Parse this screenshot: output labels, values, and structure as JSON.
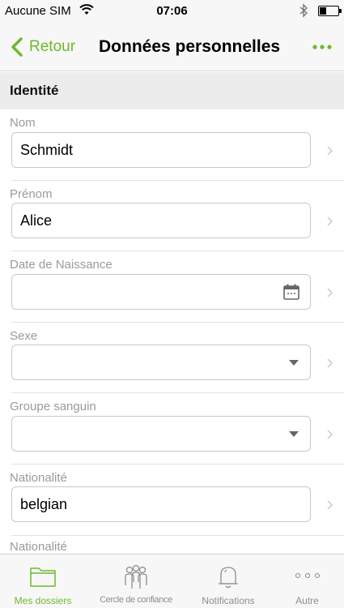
{
  "status_bar": {
    "carrier": "Aucune SIM",
    "time": "07:06"
  },
  "nav": {
    "back_label": "Retour",
    "title": "Données personnelles",
    "more_icon": "ellipsis-icon",
    "accent_color": "#6fb82d"
  },
  "section": {
    "title": "Identité"
  },
  "fields": [
    {
      "label": "Nom",
      "value": "Schmidt",
      "type": "text"
    },
    {
      "label": "Prénom",
      "value": "Alice",
      "type": "text"
    },
    {
      "label": "Date de Naissance",
      "value": "",
      "type": "date",
      "icon": "calendar-icon"
    },
    {
      "label": "Sexe",
      "value": "",
      "type": "select",
      "icon": "dropdown-arrow-icon"
    },
    {
      "label": "Groupe sanguin",
      "value": "",
      "type": "select",
      "icon": "dropdown-arrow-icon"
    },
    {
      "label": "Nationalité",
      "value": "belgian",
      "type": "text"
    },
    {
      "label": "Nationalité",
      "value": "",
      "type": "text"
    }
  ],
  "tabs": [
    {
      "label": "Mes dossiers",
      "icon": "folder-icon",
      "active": true
    },
    {
      "label": "Cercle de confiance",
      "icon": "people-group-icon",
      "active": false
    },
    {
      "label": "Notifications",
      "icon": "bell-icon",
      "active": false
    },
    {
      "label": "Autre",
      "icon": "more-dots-icon",
      "active": false
    }
  ]
}
